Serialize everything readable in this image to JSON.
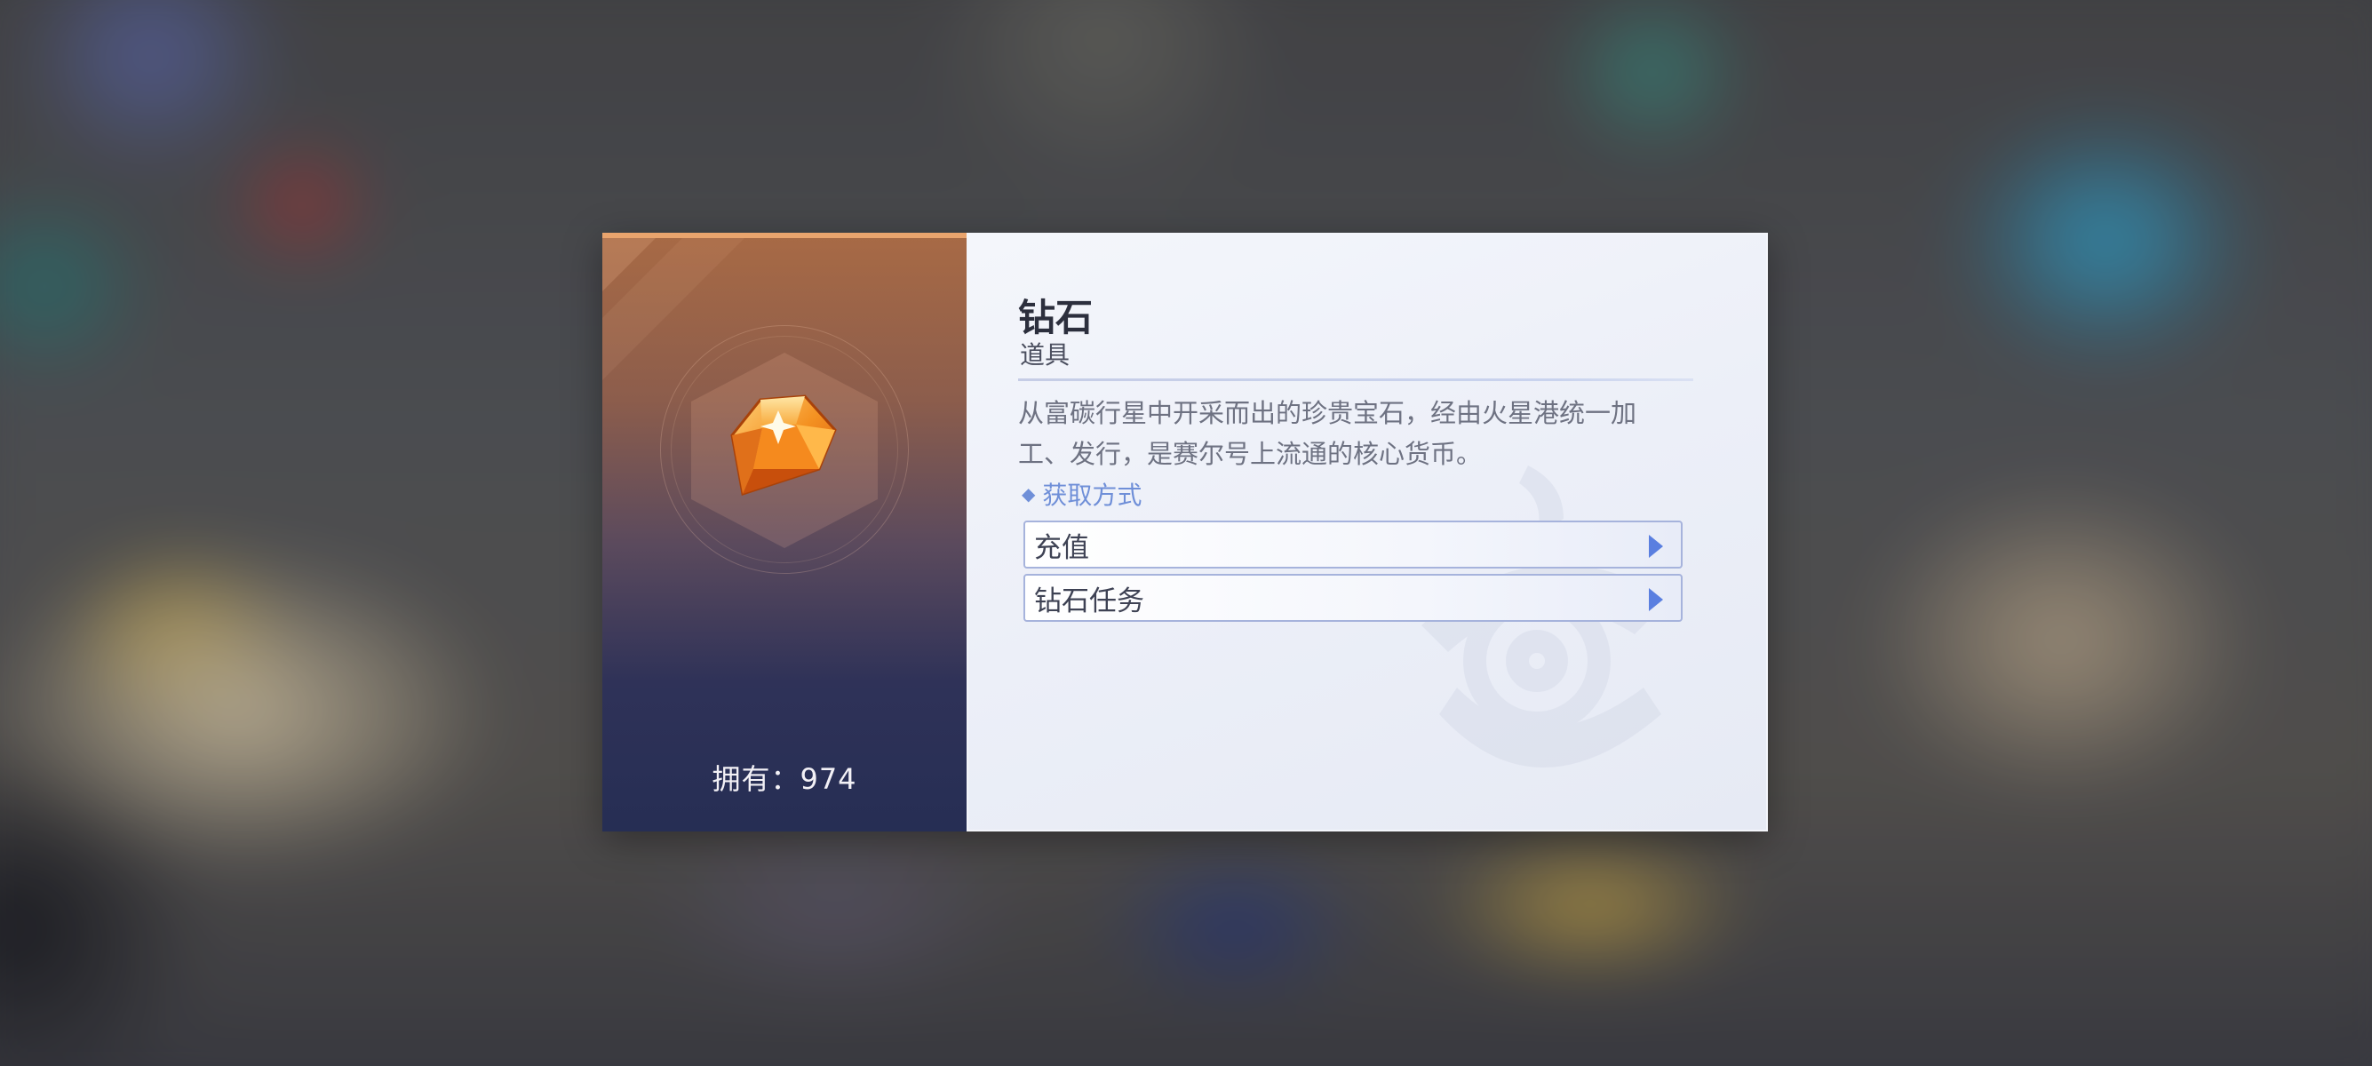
{
  "item": {
    "name": "钻石",
    "type": "道具",
    "description": "从富碳行星中开采而出的珍贵宝石，经由火星港统一加工、发行，是赛尔号上流通的核心货币。",
    "owned": "拥有：974",
    "icon": "orange-diamond-gem-icon"
  },
  "obtain": {
    "header": "获取方式",
    "options": [
      {
        "label": "充值"
      },
      {
        "label": "钻石任务"
      }
    ]
  },
  "colors": {
    "accent": "#6f8fd8",
    "button_arrow": "#5a7fe0",
    "left_panel_top": "#a86a45",
    "left_panel_bottom": "#262e54",
    "gem": "#f08a1c"
  }
}
